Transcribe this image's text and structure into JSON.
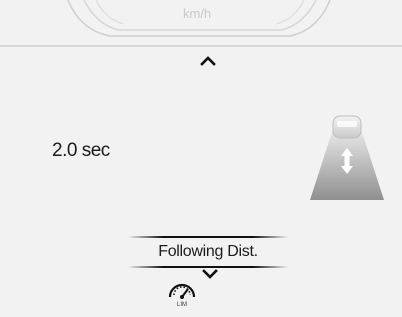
{
  "gauge": {
    "speed_unit": "km/h"
  },
  "gap_setting": {
    "value": "2.0 sec"
  },
  "menu": {
    "label": "Following Dist."
  },
  "limiter": {
    "text": "LIM"
  },
  "icons": {
    "up": "chevron-up-icon",
    "down": "chevron-down-icon",
    "acc": "acc-following-distance-icon",
    "limiter": "speed-limiter-icon"
  }
}
